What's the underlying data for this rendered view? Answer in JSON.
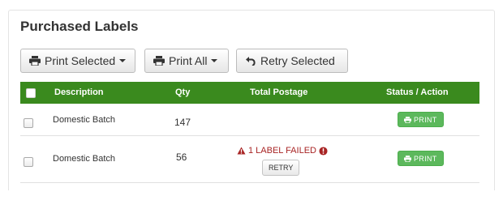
{
  "panel": {
    "title": "Purchased Labels"
  },
  "toolbar": {
    "print_selected_label": "Print Selected",
    "print_all_label": "Print All",
    "retry_selected_label": "Retry Selected"
  },
  "table": {
    "headers": {
      "description": "Description",
      "qty": "Qty",
      "total_postage": "Total Postage",
      "status_action": "Status / Action"
    },
    "rows": [
      {
        "description": "Domestic Batch",
        "qty": "147",
        "postage": "",
        "action_label": "PRINT"
      },
      {
        "description": "Domestic Batch",
        "qty": "56",
        "postage_status": "1 LABEL FAILED",
        "retry_label": "RETRY",
        "action_label": "PRINT"
      }
    ]
  },
  "colors": {
    "header_bg": "#3a8a1e",
    "print_button": "#5cb85c",
    "error_text": "#a82424"
  },
  "icons": [
    "printer-icon",
    "caret-down-icon",
    "undo-icon",
    "warning-icon",
    "info-circle-icon",
    "checkbox"
  ]
}
